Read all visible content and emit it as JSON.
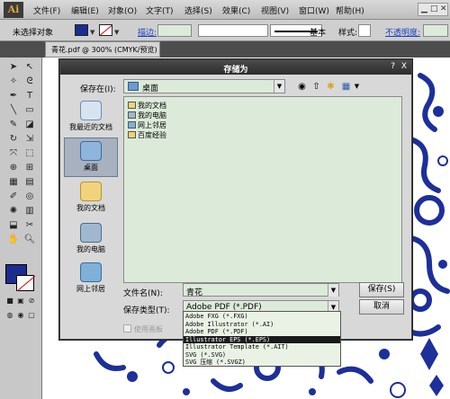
{
  "app": {
    "logo": "Ai"
  },
  "menu": [
    "文件(F)",
    "编辑(E)",
    "对象(O)",
    "文字(T)",
    "选择(S)",
    "效果(C)",
    "视图(V)",
    "窗口(W)",
    "帮助(H)"
  ],
  "control_bar": {
    "selection": "未选择对象",
    "stroke_label": "描边:",
    "basic": "基本",
    "style_label": "样式:",
    "opacity_label": "不透明度:"
  },
  "document_tab": "青花.pdf @ 300% (CMYK/预览)",
  "dialog": {
    "title": "存储为",
    "help": "?",
    "close": "X",
    "save_in_label": "保存在(I):",
    "save_in_value": "桌面",
    "places": [
      {
        "label": "我最近的文档"
      },
      {
        "label": "桌面"
      },
      {
        "label": "我的文档"
      },
      {
        "label": "我的电脑"
      },
      {
        "label": "网上邻居"
      }
    ],
    "files": [
      "我的文档",
      "我的电脑",
      "网上邻居",
      "百度经验"
    ],
    "filename_label": "文件名(N):",
    "filename_value": "青花",
    "filetype_label": "保存类型(T):",
    "filetype_value": "Adobe PDF (*.PDF)",
    "save_button": "保存(S)",
    "cancel_button": "取消",
    "artboard_label": "使用画板"
  },
  "filetype_options": [
    {
      "label": "Adobe FXG (*.FXG)",
      "selected": false
    },
    {
      "label": "Adobe Illustrator (*.AI)",
      "selected": false
    },
    {
      "label": "Adobe PDF (*.PDF)",
      "selected": false
    },
    {
      "label": "Illustrator EPS (*.EPS)",
      "selected": true
    },
    {
      "label": "Illustrator Template (*.AIT)",
      "selected": false
    },
    {
      "label": "SVG (*.SVG)",
      "selected": false
    },
    {
      "label": "SVG 压缩 (*.SVGZ)",
      "selected": false
    }
  ],
  "colors": {
    "fill": "#1d2c8f",
    "pattern": "#1d2f9a",
    "dialog_field": "#dcebd9"
  }
}
